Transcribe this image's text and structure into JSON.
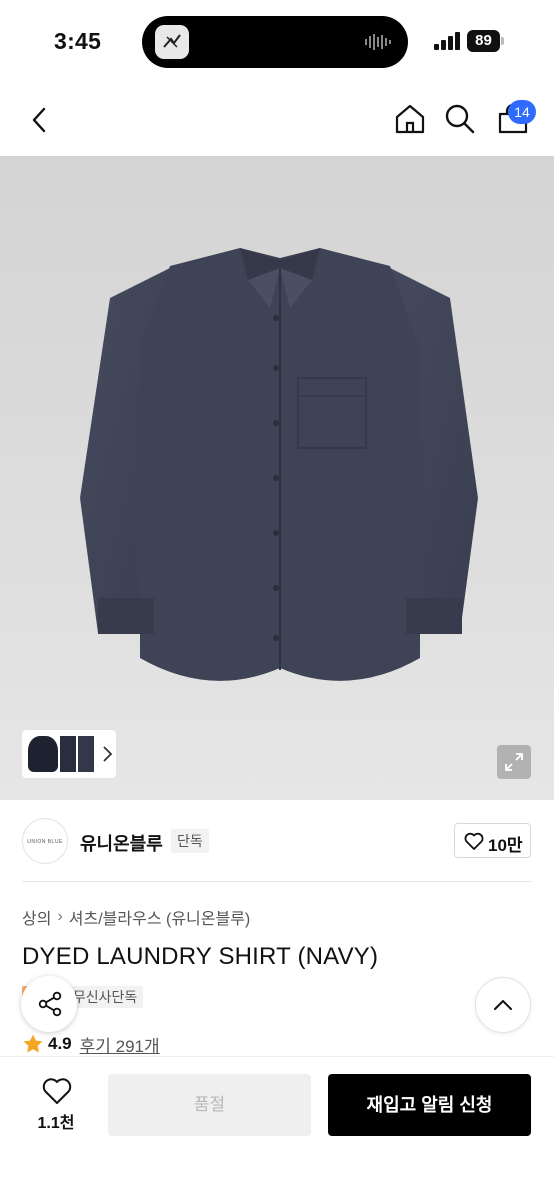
{
  "status_bar": {
    "time": "3:45",
    "battery": "89"
  },
  "nav": {
    "cart_count": "14"
  },
  "brand": {
    "logo_text": "UNION BLUE",
    "name": "유니온블루",
    "tag": "단독",
    "like_count": "10만"
  },
  "product": {
    "breadcrumb": [
      "상의",
      "셔츠/블라우스 (유니온블루)"
    ],
    "title": "DYED LAUNDRY SHIRT (NAVY)",
    "sale_tag": "일",
    "exclusive_tag": "무신사단독",
    "rating": "4.9",
    "review_label": "후기 291개"
  },
  "bottom_bar": {
    "wish_count": "1.1천",
    "soldout_label": "품절",
    "restock_label": "재입고 알림 신청"
  },
  "colors": {
    "accent_badge": "#2f6bff",
    "sale_tag": "#f6a86a",
    "star": "#f5a623",
    "shirt": "#3d4152"
  }
}
